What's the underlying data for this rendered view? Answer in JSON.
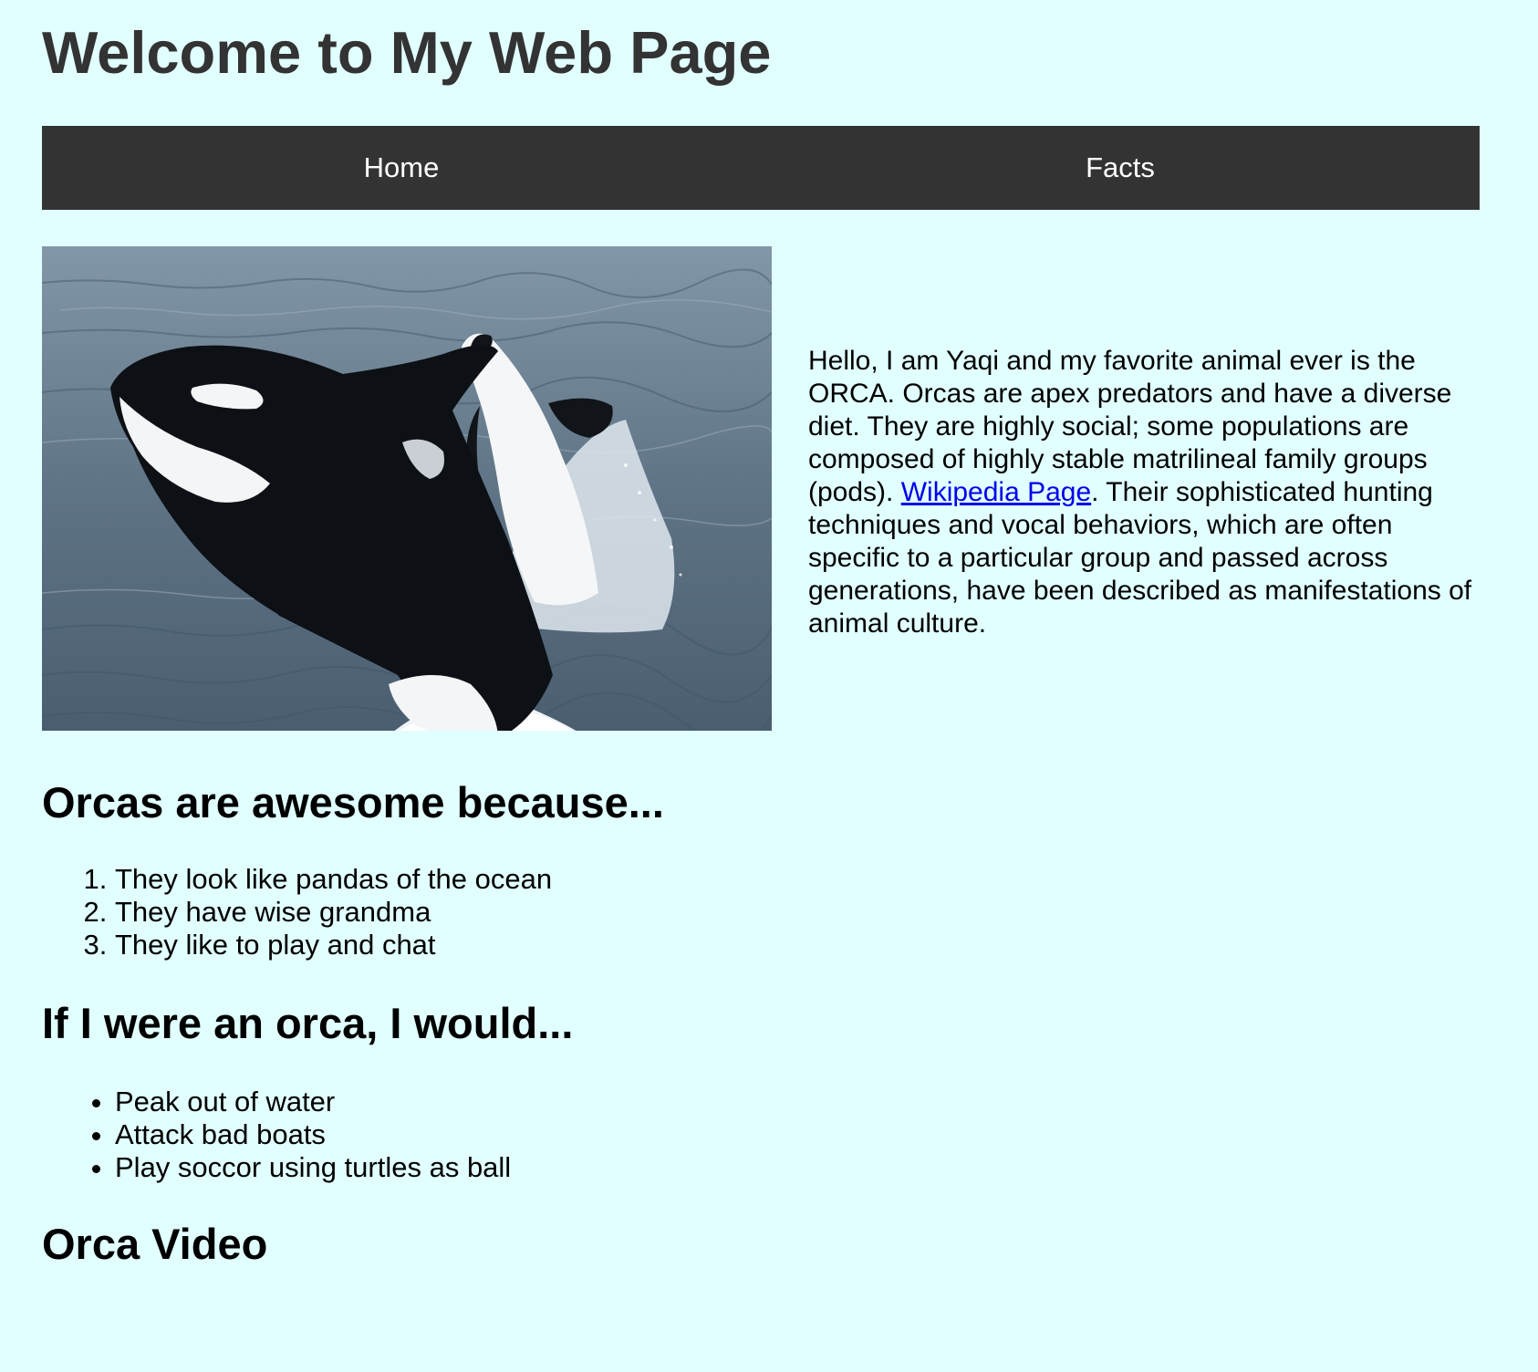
{
  "header": {
    "title": "Welcome to My Web Page"
  },
  "nav": {
    "items": [
      {
        "label": "Home"
      },
      {
        "label": "Facts"
      }
    ]
  },
  "hero": {
    "image_icon": "orca-photo",
    "intro_before_link": "Hello, I am Yaqi and my favorite animal ever is the ORCA. Orcas are apex predators and have a diverse diet. They are highly social; some populations are composed of highly stable matrilineal family groups (pods). ",
    "link_text": "Wikipedia Page",
    "intro_after_link": ". Their sophisticated hunting techniques and vocal behaviors, which are often specific to a particular group and passed across generations, have been described as manifestations of animal culture."
  },
  "awesome": {
    "heading": "Orcas are awesome because...",
    "items": [
      "They look like pandas of the ocean",
      "They have wise grandma",
      "They like to play and chat"
    ]
  },
  "would": {
    "heading": "If I were an orca, I would...",
    "items": [
      "Peak out of water",
      "Attack bad boats",
      "Play soccor using turtles as ball"
    ]
  },
  "video": {
    "heading": "Orca Video"
  },
  "colors": {
    "background": "#e1ffff",
    "navbar": "#333333",
    "title": "#333333",
    "link": "#0000ee"
  }
}
